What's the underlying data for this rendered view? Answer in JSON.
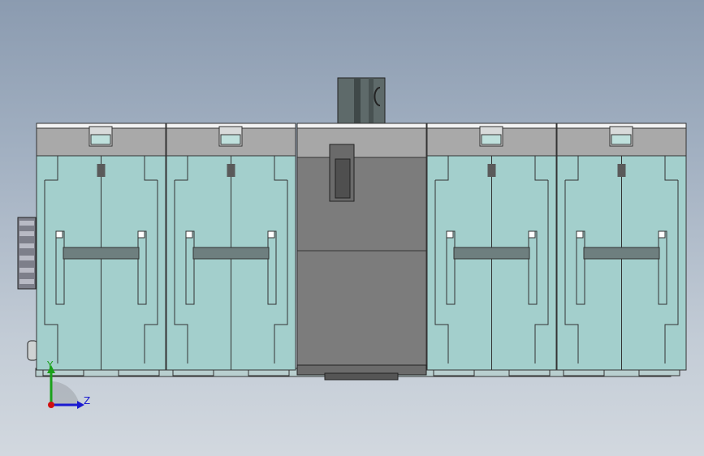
{
  "viewport": {
    "background_top": "#8b9bb0",
    "background_bottom": "#d2d8df"
  },
  "model": {
    "pole_count": 4,
    "pole_color": "#a3cfcc",
    "cap_color": "#a9a9a9",
    "center_body_color": "#7a7a7a",
    "center_pole_index": 2
  },
  "triad": {
    "y_label": "Y",
    "z_label": "Z",
    "y_color": "#1aa01a",
    "z_color": "#1a1ad0",
    "origin_color": "#d01010"
  }
}
